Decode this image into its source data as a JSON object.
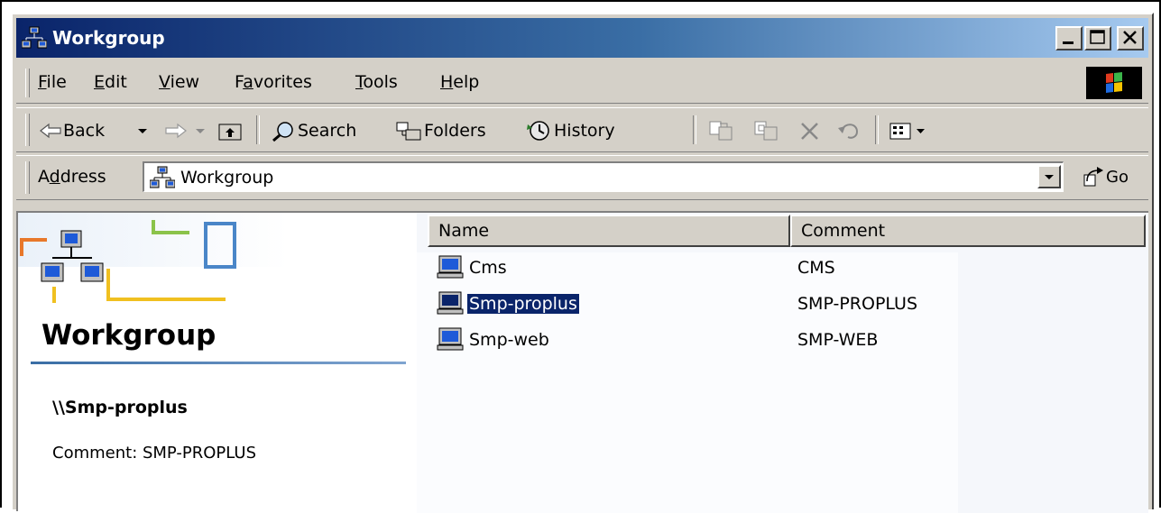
{
  "window": {
    "title": "Workgroup"
  },
  "menu": {
    "items": [
      {
        "accel": "F",
        "rest": "ile"
      },
      {
        "accel": "E",
        "rest": "dit"
      },
      {
        "accel": "V",
        "rest": "iew"
      },
      {
        "pre": "F",
        "accel": "a",
        "rest": "vorites"
      },
      {
        "accel": "T",
        "rest": "ools"
      },
      {
        "accel": "H",
        "rest": "elp"
      }
    ]
  },
  "toolbar": {
    "back_label": "Back",
    "search_label": "Search",
    "folders_label": "Folders",
    "history_label": "History"
  },
  "address": {
    "label_pre": "A",
    "label_accel": "d",
    "label_rest": "dress",
    "value": "Workgroup",
    "go_label": "Go"
  },
  "leftpane": {
    "title": "Workgroup",
    "selected_prefix": "\\\\",
    "selected_name": "Smp-proplus",
    "comment_label": "Comment: SMP-PROPLUS"
  },
  "list": {
    "columns": [
      "Name",
      "Comment"
    ],
    "rows": [
      {
        "name": "Cms",
        "comment": "CMS",
        "selected": false
      },
      {
        "name": "Smp-proplus",
        "comment": "SMP-PROPLUS",
        "selected": true
      },
      {
        "name": "Smp-web",
        "comment": "SMP-WEB",
        "selected": false
      }
    ]
  },
  "colors": {
    "titlebar_start": "#0a246a",
    "titlebar_end": "#a6caf0",
    "selection": "#0a246a",
    "chrome": "#d4d0c8"
  }
}
